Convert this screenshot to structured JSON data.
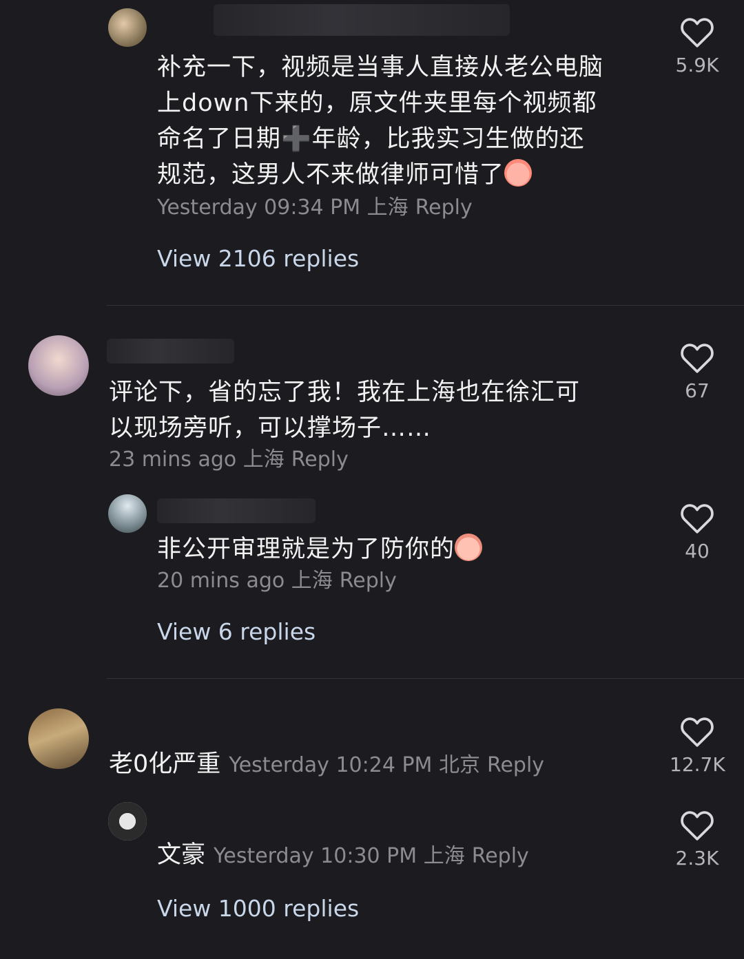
{
  "comments": [
    {
      "text_lines": [
        "补充一下，视频是当事人直接从老公电脑",
        "上down下来的，原文件夹里每个视频都",
        "命名了日期",
        "年龄，比我实习生做的还",
        "规范，这男人不来做律师可惜了"
      ],
      "plus_glyph": "➕",
      "time": "Yesterday 09:34 PM 上海",
      "reply_label": "Reply",
      "likes": "5.9K",
      "view_replies": "View 2106 replies"
    },
    {
      "text_lines": [
        "评论下，省的忘了我！我在上海也在徐汇可",
        "以现场旁听，可以撑场子……"
      ],
      "time": "23 mins ago 上海",
      "reply_label": "Reply",
      "likes": "67",
      "reply": {
        "text": "非公开审理就是为了防你的",
        "time": "20 mins ago 上海",
        "reply_label": "Reply",
        "likes": "40"
      },
      "view_replies": "View 6 replies"
    },
    {
      "text": "老0化严重",
      "time": "Yesterday 10:24 PM 北京",
      "reply_label": "Reply",
      "likes": "12.7K",
      "reply": {
        "text": "文豪",
        "time": "Yesterday 10:30 PM 上海",
        "reply_label": "Reply",
        "likes": "2.3K"
      },
      "view_replies": "View 1000 replies"
    }
  ],
  "icons": {
    "like": "heart-outline-icon"
  },
  "colors": {
    "background": "#1c1b1f",
    "meta_text": "#8b8b90",
    "view_replies": "#c9d7ea"
  }
}
